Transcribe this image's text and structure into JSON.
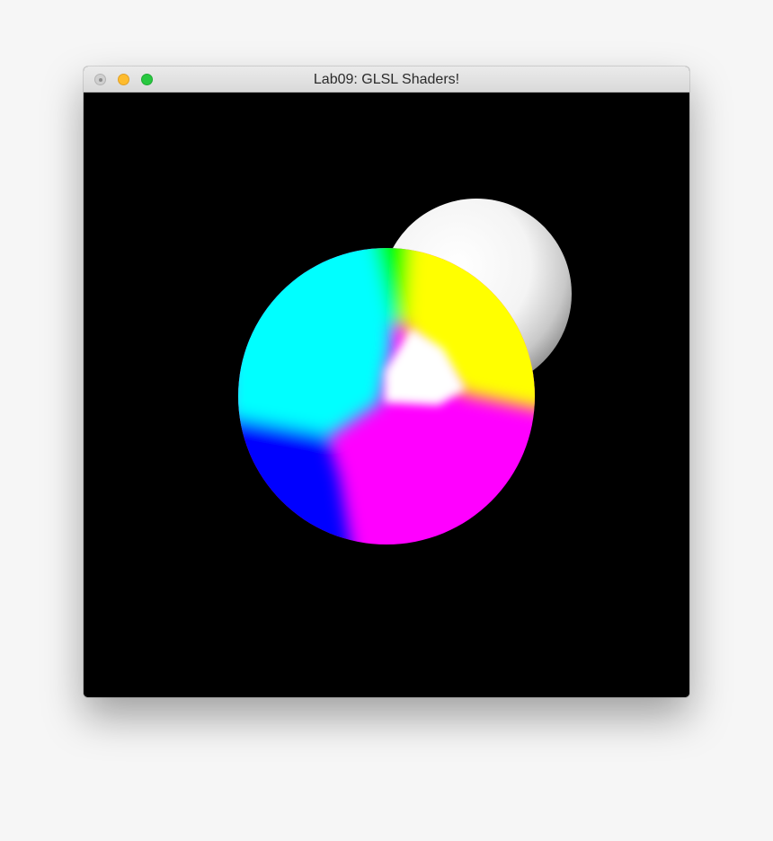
{
  "window": {
    "title": "Lab09: GLSL Shaders!",
    "controls": {
      "close": "close-button",
      "minimize": "minimize-button",
      "zoom": "zoom-button"
    }
  },
  "scene": {
    "background_color": "#000000",
    "spheres": [
      {
        "name": "white-sphere",
        "color": "#ffffff"
      },
      {
        "name": "rgb-normal-sphere",
        "colors": {
          "cyan": "#00ffff",
          "yellow": "#ffff00",
          "magenta": "#ff00ff",
          "blue": "#0000ff",
          "green": "#00ff00",
          "red": "#ff0000",
          "white": "#ffffff"
        }
      }
    ]
  }
}
